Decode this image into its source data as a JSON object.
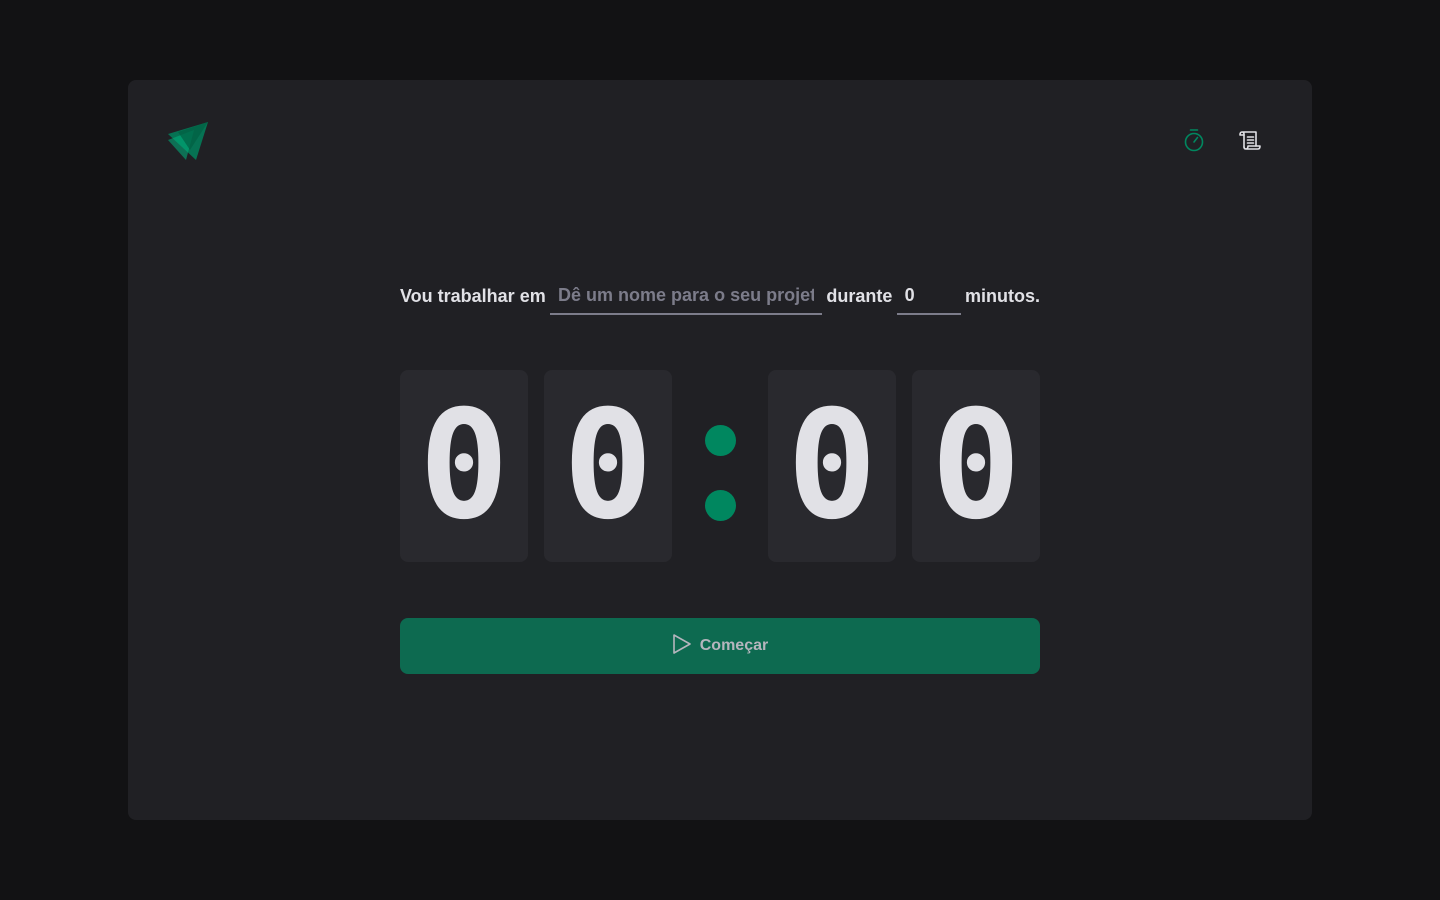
{
  "header": {
    "logo_icon": "ignite-triangle-logo",
    "nav": [
      {
        "icon": "timer-icon",
        "color": "#00875f"
      },
      {
        "icon": "scroll-icon",
        "color": "#e1e1e6"
      }
    ]
  },
  "form": {
    "prefix_label": "Vou trabalhar em",
    "task_placeholder": "Dê um nome para o seu projeto",
    "task_value": "",
    "middle_label": "durante",
    "minutes_value": "0",
    "suffix_label": "minutos."
  },
  "countdown": {
    "minutes_tens": "0",
    "minutes_ones": "0",
    "seconds_tens": "0",
    "seconds_ones": "0"
  },
  "start_button": {
    "icon": "play-icon",
    "label": "Começar",
    "disabled": true
  },
  "colors": {
    "background": "#121214",
    "card": "#202024",
    "digit_box": "#29292e",
    "accent": "#00875f",
    "button": "#0d6a50",
    "text": "#e1e1e6",
    "placeholder": "#7c7c8a"
  }
}
